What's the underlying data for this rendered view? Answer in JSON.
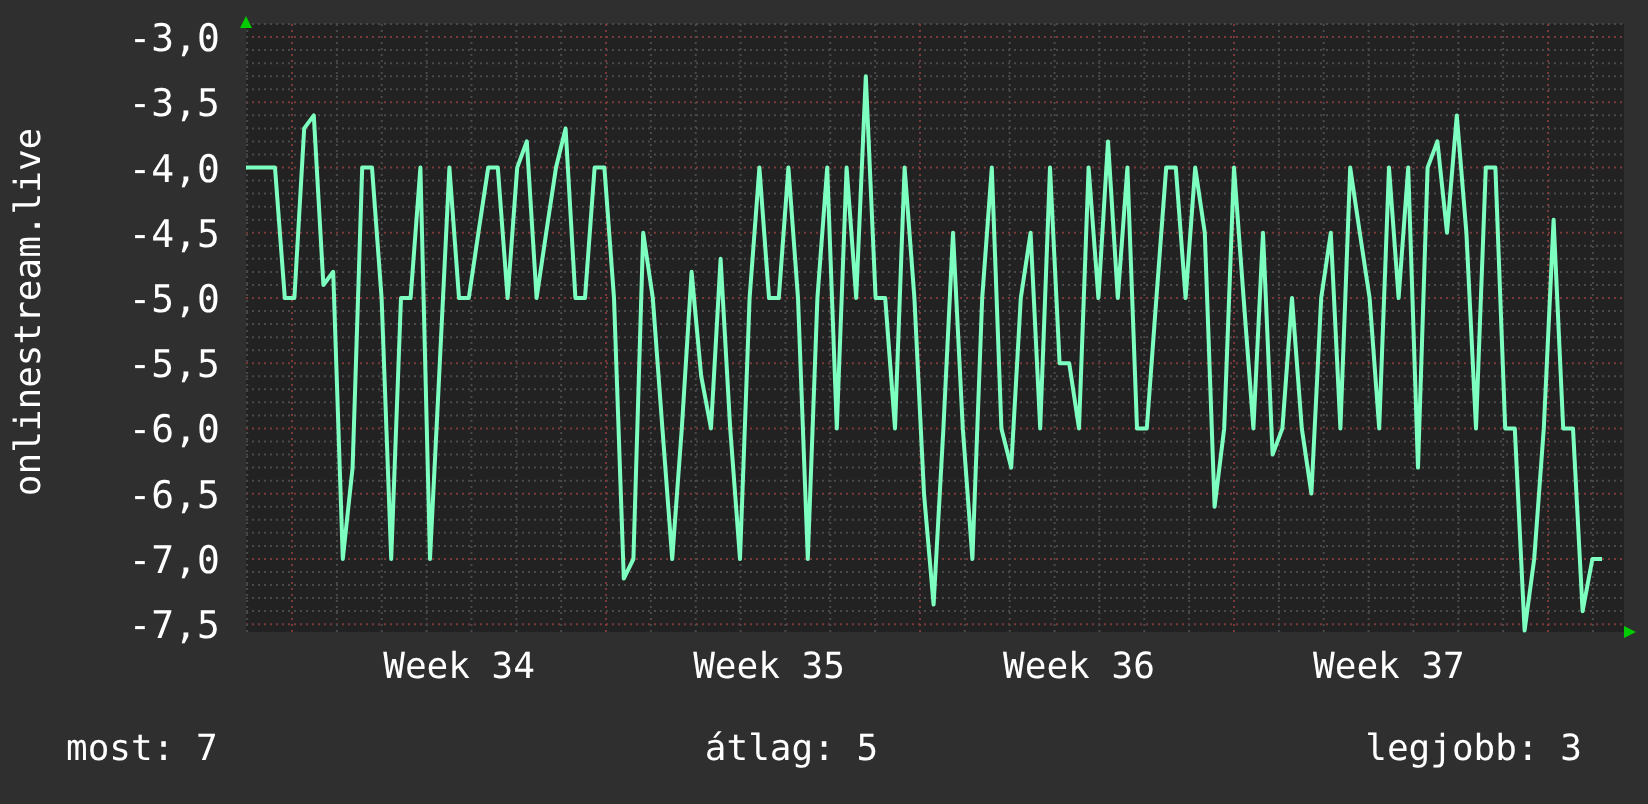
{
  "chart": {
    "chart_data": {
      "type": "line",
      "grid": true,
      "ylabel": "onlinestream.live",
      "ylim": [
        -7.56,
        -2.9
      ],
      "yticks": [
        {
          "value": -3.0,
          "label": "-3,0"
        },
        {
          "value": -3.5,
          "label": "-3,5"
        },
        {
          "value": -4.0,
          "label": "-4,0"
        },
        {
          "value": -4.5,
          "label": "-4,5"
        },
        {
          "value": -5.0,
          "label": "-5,0"
        },
        {
          "value": -5.5,
          "label": "-5,5"
        },
        {
          "value": -6.0,
          "label": "-6,0"
        },
        {
          "value": -6.5,
          "label": "-6,5"
        },
        {
          "value": -7.0,
          "label": "-7,0"
        },
        {
          "value": -7.5,
          "label": "-7,5"
        }
      ],
      "categories": [
        null,
        null,
        null,
        null,
        null,
        null,
        null,
        null,
        null,
        null,
        null,
        null,
        null,
        null,
        null,
        null,
        null,
        null,
        null,
        null,
        null,
        null,
        "Week 34",
        null,
        null,
        null,
        null,
        null,
        null,
        null,
        null,
        null,
        null,
        null,
        null,
        null,
        null,
        null,
        null,
        null,
        null,
        null,
        null,
        null,
        null,
        null,
        null,
        null,
        null,
        null,
        null,
        null,
        null,
        null,
        "Week 35",
        null,
        null,
        null,
        null,
        null,
        null,
        null,
        null,
        null,
        null,
        null,
        null,
        null,
        null,
        null,
        null,
        null,
        null,
        null,
        null,
        null,
        null,
        null,
        null,
        null,
        null,
        null,
        null,
        null,
        null,
        null,
        "Week 36",
        null,
        null,
        null,
        null,
        null,
        null,
        null,
        null,
        null,
        null,
        null,
        null,
        null,
        null,
        null,
        null,
        null,
        null,
        null,
        null,
        null,
        null,
        null,
        null,
        null,
        null,
        null,
        null,
        null,
        null,
        null,
        "Week 37",
        null,
        null,
        null,
        null,
        null,
        null,
        null,
        null,
        null,
        null,
        null,
        null,
        null,
        null,
        null,
        null,
        null,
        null,
        null,
        null,
        null,
        null
      ],
      "series": [
        {
          "color": "#7dffc0",
          "values": [
            -4.0,
            -4.0,
            -4.0,
            -4.0,
            -5.0,
            -5.0,
            -3.7,
            -3.6,
            -4.9,
            -4.8,
            -7.0,
            -6.3,
            -4.0,
            -4.0,
            -5.0,
            -7.0,
            -5.0,
            -5.0,
            -4.0,
            -7.0,
            -5.5,
            -4.0,
            -5.0,
            -5.0,
            -4.5,
            -4.0,
            -4.0,
            -5.0,
            -4.0,
            -3.8,
            -5.0,
            -4.5,
            -4.0,
            -3.7,
            -5.0,
            -5.0,
            -4.0,
            -4.0,
            -5.0,
            -7.15,
            -7.0,
            -4.5,
            -5.0,
            -6.0,
            -7.0,
            -6.0,
            -4.8,
            -5.6,
            -6.0,
            -4.7,
            -6.0,
            -7.0,
            -5.0,
            -4.0,
            -5.0,
            -5.0,
            -4.0,
            -5.0,
            -7.0,
            -5.0,
            -4.0,
            -6.0,
            -4.0,
            -5.0,
            -3.3,
            -5.0,
            -5.0,
            -6.0,
            -4.0,
            -5.0,
            -6.5,
            -7.35,
            -6.0,
            -4.5,
            -6.0,
            -7.0,
            -5.0,
            -4.0,
            -6.0,
            -6.3,
            -5.0,
            -4.5,
            -6.0,
            -4.0,
            -5.5,
            -5.5,
            -6.0,
            -4.0,
            -5.0,
            -3.8,
            -5.0,
            -4.0,
            -6.0,
            -6.0,
            -5.0,
            -4.0,
            -4.0,
            -5.0,
            -4.0,
            -4.5,
            -6.6,
            -6.0,
            -4.0,
            -5.0,
            -6.0,
            -4.5,
            -6.2,
            -6.0,
            -5.0,
            -6.0,
            -6.5,
            -5.0,
            -4.5,
            -6.0,
            -4.0,
            -4.5,
            -5.0,
            -6.0,
            -4.0,
            -5.0,
            -4.0,
            -6.3,
            -4.0,
            -3.8,
            -4.5,
            -3.6,
            -4.5,
            -6.0,
            -4.0,
            -4.0,
            -6.0,
            -6.0,
            -7.55,
            -7.0,
            -6.0,
            -4.4,
            -6.0,
            -6.0,
            -7.4,
            -7.0,
            -7.0
          ]
        }
      ]
    }
  },
  "stats": [
    {
      "label": "most: 7"
    },
    {
      "label": "átlag: 5"
    },
    {
      "label": "legjobb: 3"
    }
  ]
}
